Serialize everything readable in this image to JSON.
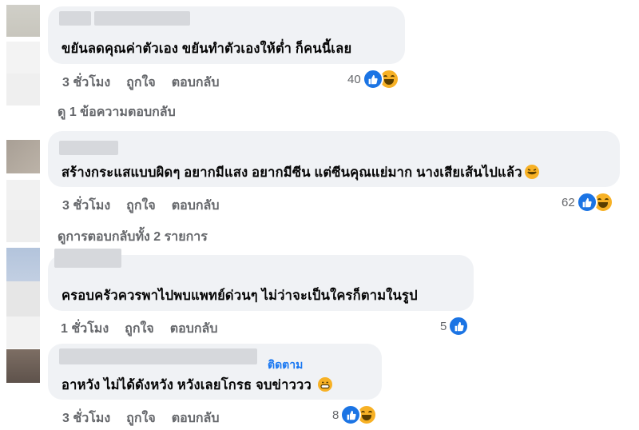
{
  "comments": [
    {
      "text": "ขยันลดคุณค่าตัวเอง ขยันทำตัวเองให้ต่ำ ก็คนนี้เลย",
      "time": "3 ชั่วโมง",
      "like": "ถูกใจ",
      "reply": "ตอบกลับ",
      "reaction_count": "40",
      "reactions": [
        "like-icon",
        "haha-icon"
      ],
      "replies_link": "ดู 1 ข้อความตอบกลับ"
    },
    {
      "text": "สร้างกระแสแบบผิดๆ อยากมีแสง อยากมีซีน แต่ซีนคุณแย่มาก นางเสียเส้นไปแล้ว",
      "text_emoji": "rolling-laughing-emoji",
      "time": "3 ชั่วโมง",
      "like": "ถูกใจ",
      "reply": "ตอบกลับ",
      "reaction_count": "62",
      "reactions": [
        "like-icon",
        "haha-icon"
      ],
      "replies_link": "ดูการตอบกลับทั้ง 2 รายการ"
    },
    {
      "text": "ครอบครัวควรพาไปพบแพทย์ด่วนๆ ไม่ว่าจะเป็นใครก็ตามในรูป",
      "time": "1 ชั่วโมง",
      "like": "ถูกใจ",
      "reply": "ตอบกลับ",
      "reaction_count": "5",
      "reactions": [
        "like-icon"
      ]
    },
    {
      "follow": "ติดตาม",
      "text": "อาหวัง ไม่ได้ดังหวัง หวังเลยโกรธ จบข่าววว",
      "text_emoji": "grinning-emoji",
      "time": "3 ชั่วโมง",
      "like": "ถูกใจ",
      "reply": "ตอบกลับ",
      "reaction_count": "8",
      "reactions": [
        "like-icon",
        "haha-icon"
      ]
    }
  ],
  "colors": {
    "like_blue": "#1b74e4",
    "bubble_bg": "#f0f2f5",
    "meta_gray": "#65676b",
    "link_blue": "#1877f2"
  }
}
